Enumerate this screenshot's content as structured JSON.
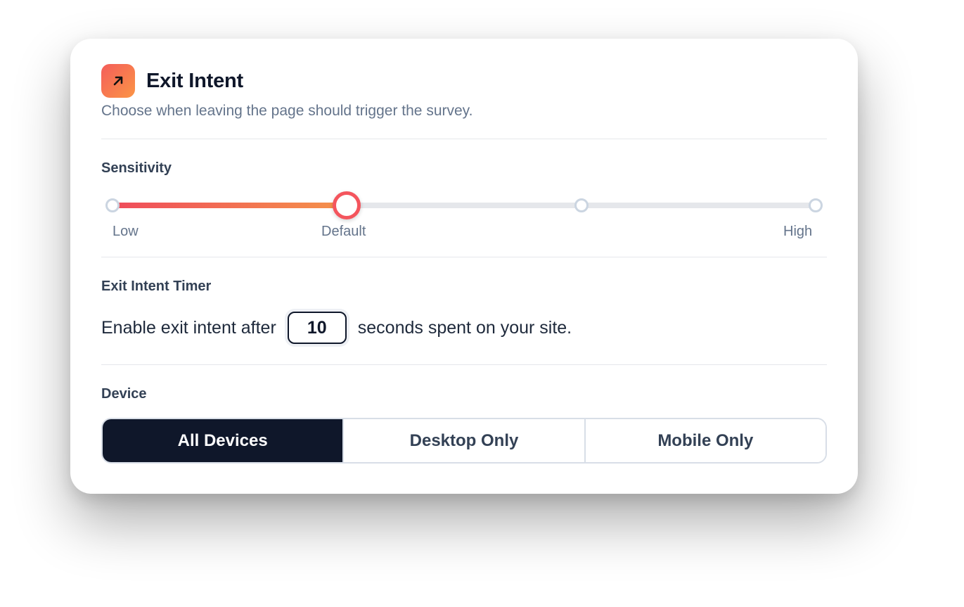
{
  "header": {
    "icon": "arrow-up-right-icon",
    "title": "Exit Intent",
    "subtitle": "Choose when leaving the page should trigger the survey."
  },
  "sensitivity": {
    "label": "Sensitivity",
    "stops": 4,
    "selected_index": 1,
    "labels": {
      "low": "Low",
      "default": "Default",
      "high": "High"
    }
  },
  "timer": {
    "label": "Exit Intent Timer",
    "prefix": "Enable exit intent after",
    "value": "10",
    "suffix": "seconds spent on your site."
  },
  "device": {
    "label": "Device",
    "options": [
      "All Devices",
      "Desktop Only",
      "Mobile Only"
    ],
    "selected": "All Devices"
  },
  "colors": {
    "accent_start": "#ef4b5b",
    "accent_end": "#f5934a",
    "dark": "#0f172a"
  }
}
